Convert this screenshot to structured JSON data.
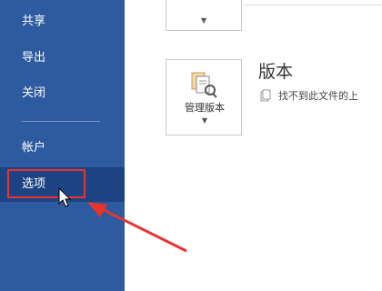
{
  "sidebar": {
    "items": [
      {
        "label": "共享"
      },
      {
        "label": "导出"
      },
      {
        "label": "关闭"
      },
      {
        "label": "帐户"
      },
      {
        "label": "选项"
      }
    ]
  },
  "versions": {
    "manage_button_label": "管理版本",
    "title": "版本",
    "info_text": "找不到此文件的上"
  },
  "colors": {
    "sidebar_bg": "#2e5aa0",
    "sidebar_hover": "#1e4384",
    "annotation_red": "#e8342f"
  },
  "icons": {
    "manage_versions": "manage-versions-icon",
    "document": "document-icon",
    "cursor": "mouse-cursor-icon"
  }
}
